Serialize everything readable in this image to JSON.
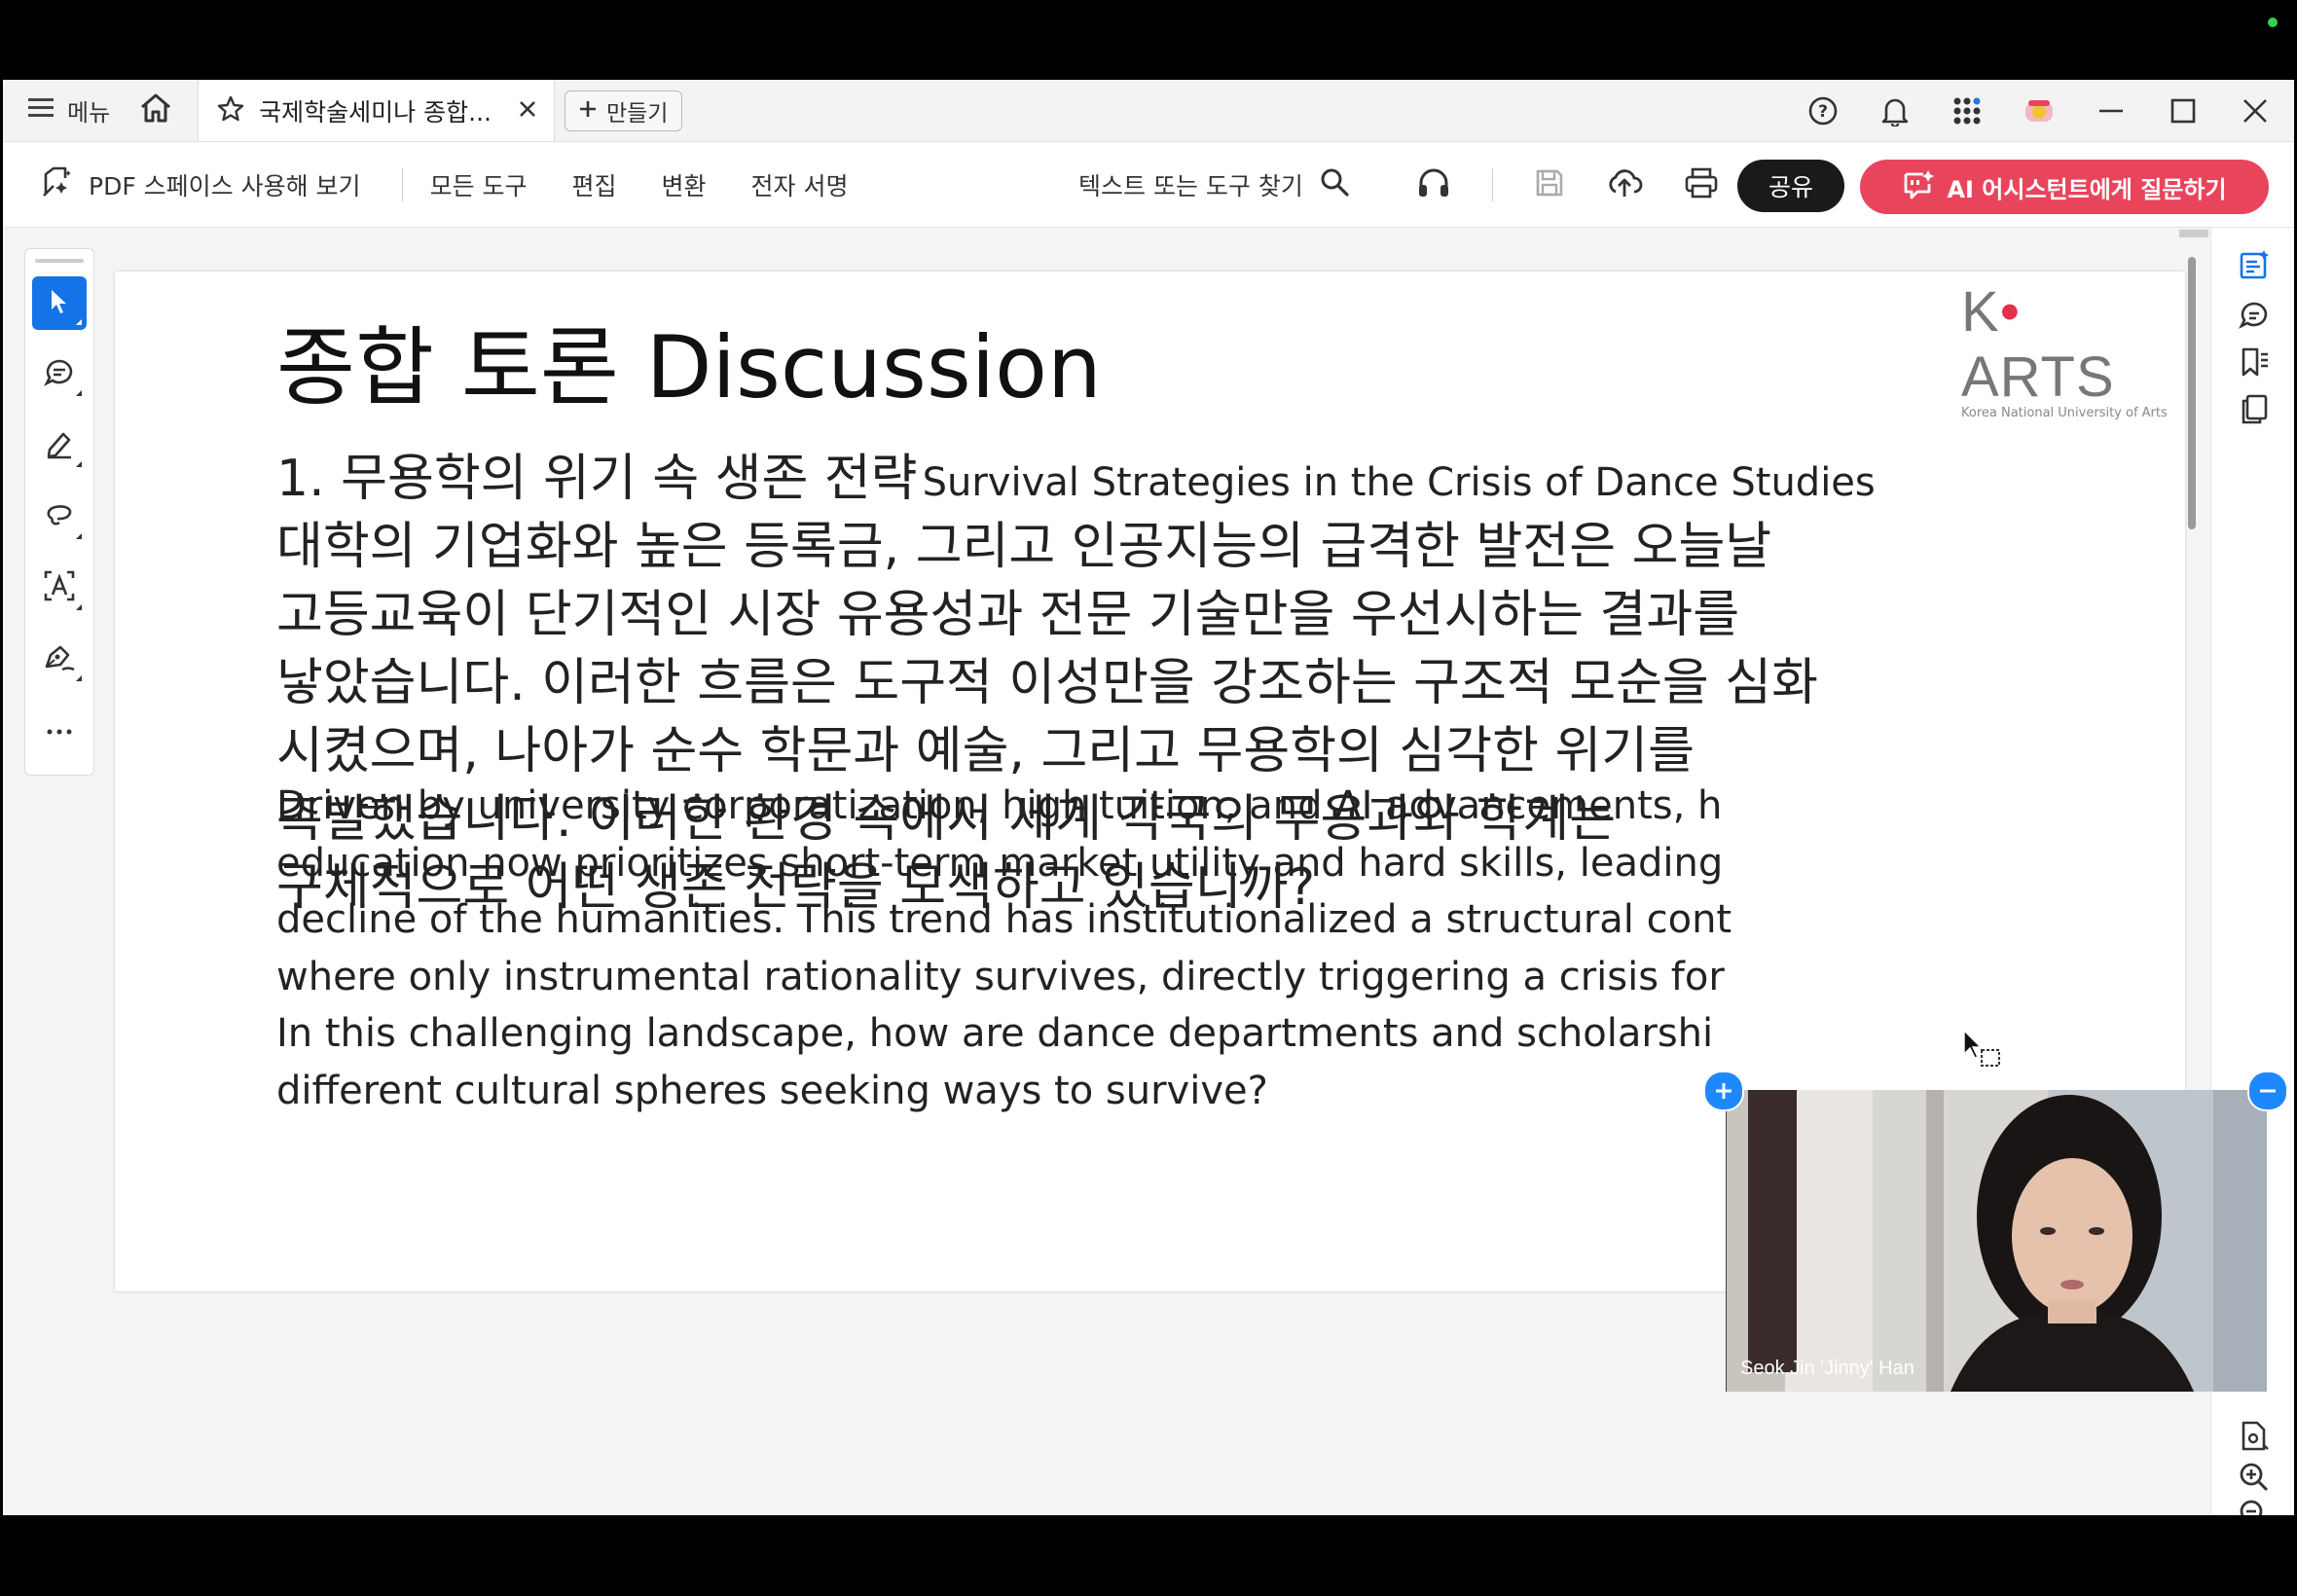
{
  "tabbar": {
    "menu_label": "메뉴",
    "tab_title": "국제학술세미나 종합...",
    "new_label": "만들기"
  },
  "toolbar": {
    "try_space": "PDF 스페이스 사용해 보기",
    "all_tools": "모든 도구",
    "edit": "편집",
    "convert": "변환",
    "esign": "전자 서명",
    "find": "텍스트 또는 도구 찾기",
    "share": "공유",
    "ai_assistant": "AI 어시스턴트에게 질문하기"
  },
  "page": {
    "logo_text": "K ARTS",
    "logo_sub": "Korea National University of Arts",
    "heading": "종합 토론 Discussion",
    "q1_ko": "1. 무용학의 위기 속 생존 전략",
    "q1_en": "Survival Strategies in the Crisis of Dance Studies",
    "ko_lines": [
      "대학의 기업화와 높은 등록금, 그리고 인공지능의 급격한 발전은 오늘날",
      "고등교육이 단기적인 시장 유용성과 전문 기술만을 우선시하는 결과를",
      "낳았습니다. 이러한 흐름은 도구적 이성만을 강조하는 구조적 모순을 심화",
      "시켰으며, 나아가 순수 학문과 예술, 그리고 무용학의 심각한 위기를",
      "촉발했습니다. 이러한 환경 속에서 세계 각국의 무용과와 학계는",
      "구체적으로 어떤 생존 전략을 모색하고 있습니까?"
    ],
    "en_lines": [
      "Driven by university corporatization, high tuition, and AI advancements, h",
      "education now prioritizes short-term market utility and hard skills, leading",
      "decline of the humanities. This trend has institutionalized a structural cont",
      "where only instrumental rationality survives, directly triggering a crisis for",
      "In this challenging landscape, how are dance departments and scholarshi",
      "different cultural spheres seeking ways to survive?"
    ]
  },
  "video": {
    "participant_name": "Seok Jin 'Jinny' Han"
  },
  "colors": {
    "ai_button": "#e8455d",
    "active_tool": "#1473e6",
    "share_button": "#1a1a1a"
  }
}
